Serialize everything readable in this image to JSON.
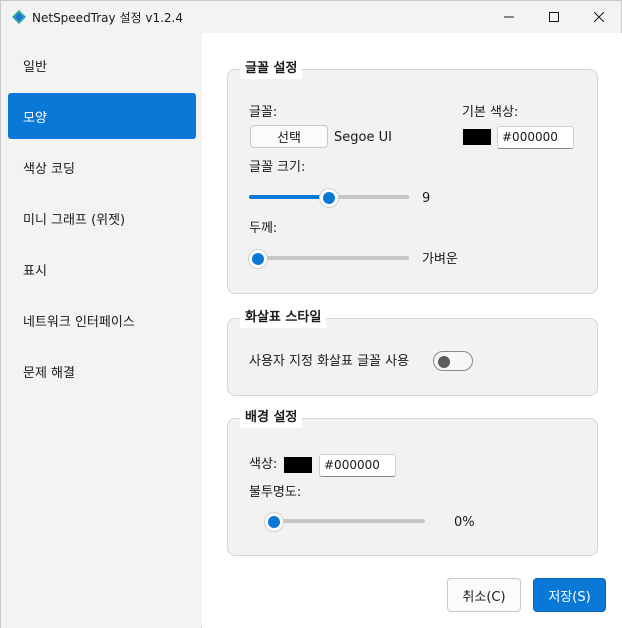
{
  "window": {
    "title": "NetSpeedTray 설정 v1.2.4"
  },
  "sidebar": {
    "items": [
      {
        "label": "일반",
        "active": false
      },
      {
        "label": "모양",
        "active": true
      },
      {
        "label": "색상 코딩",
        "active": false
      },
      {
        "label": "미니 그래프 (위젯)",
        "active": false
      },
      {
        "label": "표시",
        "active": false
      },
      {
        "label": "네트워크 인터페이스",
        "active": false
      },
      {
        "label": "문제 해결",
        "active": false
      }
    ]
  },
  "font_settings": {
    "title": "글꼴 설정",
    "font_label": "글꼴:",
    "select_button": "선택",
    "font_name": "Segoe UI",
    "default_color_label": "기본 색상:",
    "default_color_hex": "#000000",
    "font_size_label": "글꼴 크기:",
    "font_size_value": "9",
    "font_size_fraction": 0.5,
    "weight_label": "두께:",
    "weight_value": "가벼운",
    "weight_fraction": 0.0
  },
  "arrow_style": {
    "title": "화살표 스타일",
    "custom_font_label": "사용자 지정 화살표 글꼴 사용",
    "custom_font_enabled": false
  },
  "background": {
    "title": "배경 설정",
    "color_label": "색상:",
    "color_hex": "#000000",
    "opacity_label": "불투명도:",
    "opacity_value": "0%",
    "opacity_fraction": 0.0
  },
  "footer": {
    "cancel_label": "취소(C)",
    "save_label": "저장(S)"
  },
  "colors": {
    "accent": "#0a78d7",
    "swatch": "#000000"
  }
}
